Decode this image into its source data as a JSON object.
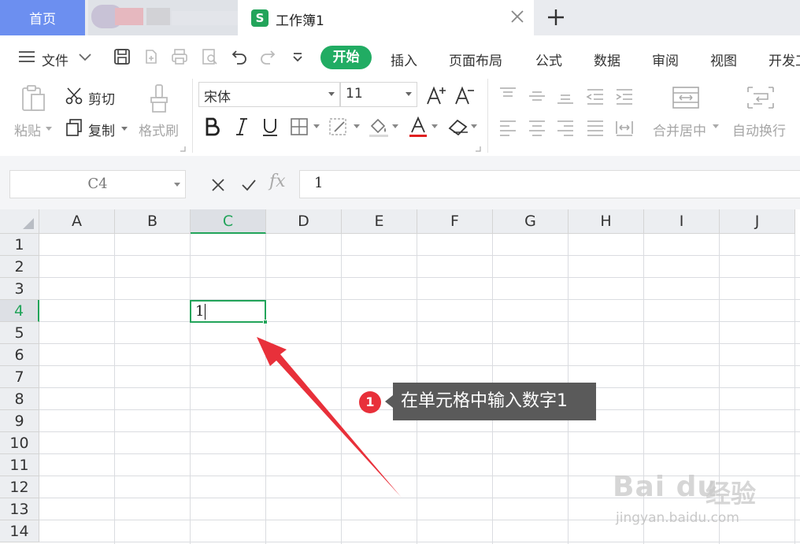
{
  "tabs": {
    "home": "首页",
    "document": "工作簿1",
    "document_logo": "S"
  },
  "menu": {
    "file": "文件",
    "items": [
      "开始",
      "插入",
      "页面布局",
      "公式",
      "数据",
      "审阅",
      "视图",
      "开发工"
    ]
  },
  "ribbon": {
    "paste": "粘贴",
    "cut": "剪切",
    "copy": "复制",
    "format_painter": "格式刷",
    "font_name": "宋体",
    "font_size": "11",
    "merge_center": "合并居中",
    "wrap_text": "自动换行"
  },
  "formula_bar": {
    "name_box": "C4",
    "fx_label": "fx",
    "value": "1"
  },
  "grid": {
    "columns": [
      "A",
      "B",
      "C",
      "D",
      "E",
      "F",
      "G",
      "H",
      "I",
      "J"
    ],
    "rows": [
      "1",
      "2",
      "3",
      "4",
      "5",
      "6",
      "7",
      "8",
      "9",
      "10",
      "11",
      "12",
      "13",
      "14"
    ],
    "selected_column": "C",
    "selected_row": "4",
    "active_cell_value": "1"
  },
  "annotation": {
    "badge": "1",
    "text": "在单元格中输入数字1"
  },
  "watermark": {
    "main": "Bai du",
    "cn": "经验",
    "sub": "jingyan.baidu.com"
  },
  "colors": {
    "accent_green": "#21ac63",
    "home_tab_blue": "#6c8ff0",
    "arrow_red": "#e8303a",
    "callout_bg": "#5a5a5a"
  }
}
